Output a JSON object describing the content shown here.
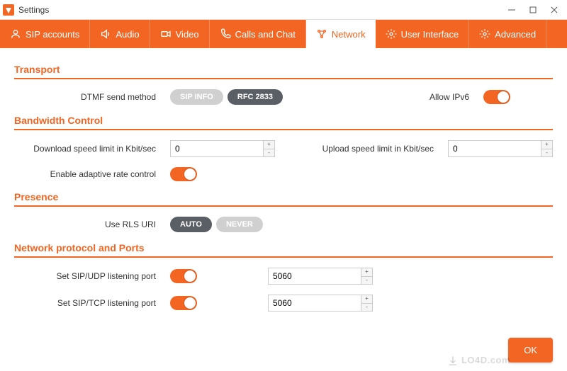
{
  "window": {
    "title": "Settings"
  },
  "tabs": {
    "sip": "SIP accounts",
    "audio": "Audio",
    "video": "Video",
    "calls": "Calls and Chat",
    "network": "Network",
    "ui": "User Interface",
    "advanced": "Advanced"
  },
  "sections": {
    "transport": "Transport",
    "bandwidth": "Bandwidth Control",
    "presence": "Presence",
    "ports": "Network protocol and Ports"
  },
  "labels": {
    "dtmf": "DTMF send method",
    "ipv6": "Allow IPv6",
    "dl_limit": "Download speed limit in Kbit/sec",
    "ul_limit": "Upload speed limit in Kbit/sec",
    "adaptive": "Enable adaptive rate control",
    "rls": "Use RLS URI",
    "sip_udp": "Set SIP/UDP listening port",
    "sip_tcp": "Set SIP/TCP listening port"
  },
  "pills": {
    "sip_info": "SIP INFO",
    "rfc2833": "RFC 2833",
    "auto": "AUTO",
    "never": "NEVER"
  },
  "values": {
    "dl_speed": "0",
    "ul_speed": "0",
    "udp_port": "5060",
    "tcp_port": "5060"
  },
  "ok": "OK",
  "watermark": "LO4D.com"
}
